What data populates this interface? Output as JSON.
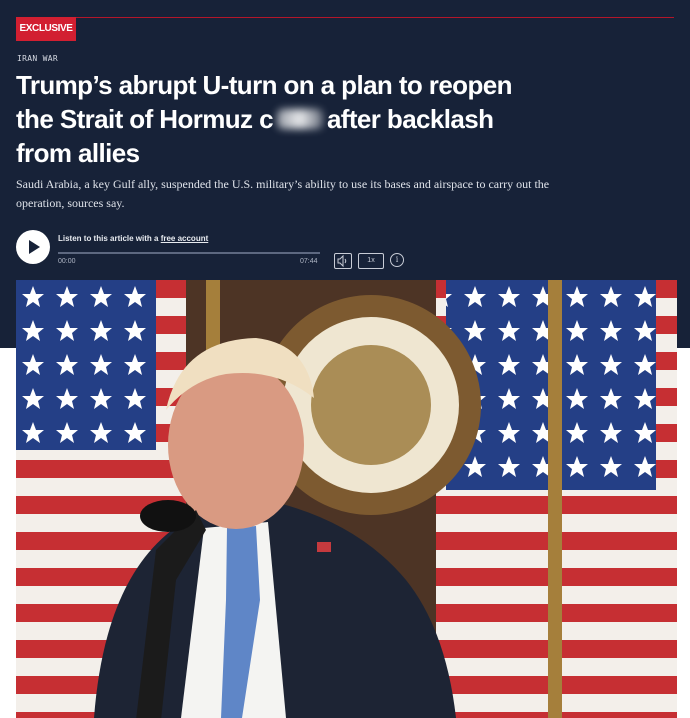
{
  "article": {
    "badge": "EXCLUSIVE",
    "kicker": "IRAN WAR",
    "headline_part1": "Trump’s abrupt U-turn on a plan to reopen the Strait of Hormuz c",
    "headline_part2": "after backlash from allies",
    "dek": "Saudi Arabia, a key Gulf ally, suspended the U.S. military’s ability to use its bases and airspace to carry out the operation, sources say."
  },
  "audio": {
    "listen_prefix": "Listen to this article with a ",
    "listen_link": "free account",
    "start_time": "00:00",
    "end_time": "07:44",
    "speed_label": "1x",
    "volume_icon": "speaker-icon",
    "info_icon": "info-icon"
  },
  "colors": {
    "header_bg": "#172238",
    "badge_red": "#d21f31",
    "text_white": "#ffffff"
  }
}
